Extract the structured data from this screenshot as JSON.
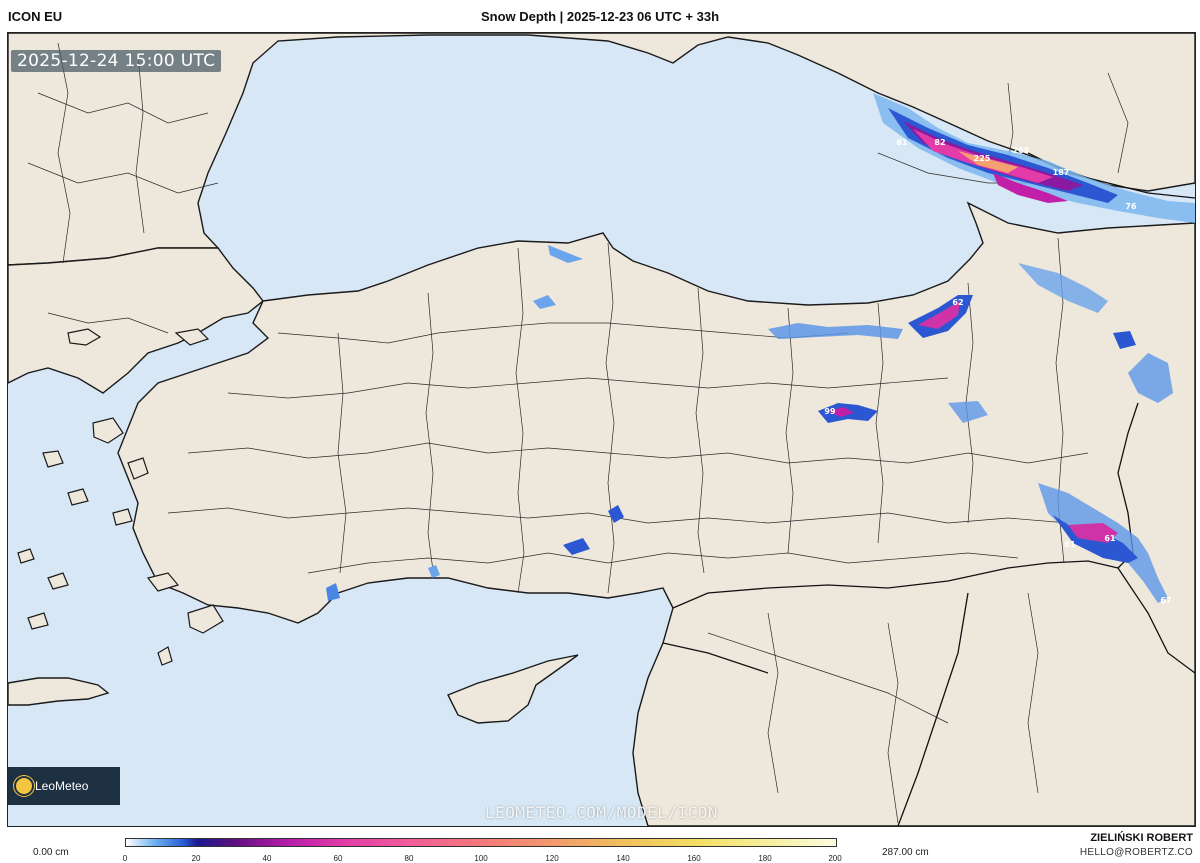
{
  "header": {
    "model": "ICON EU",
    "title": "Snow Depth | 2025-12-23 06 UTC + 33h"
  },
  "map": {
    "valid_time": "2025-12-24 15:00 UTC",
    "watermark": "LEOMETEO.COM/MODEL/ICON",
    "logo": "LeoMeteo",
    "colors": {
      "sea": "#d7e7f6",
      "land": "#eee7db",
      "border": "#1a1a1a"
    },
    "snow_labels": [
      "81",
      "82",
      "225",
      "268",
      "187",
      "76",
      "62",
      "99",
      "61",
      "61",
      "67"
    ]
  },
  "legend": {
    "min_label": "0.00 cm",
    "max_label": "287.00 cm",
    "ticks": [
      "0",
      "20",
      "40",
      "60",
      "80",
      "100",
      "120",
      "140",
      "160",
      "180",
      "200"
    ]
  },
  "footer": {
    "author": "ZIELIŃSKI ROBERT",
    "email": "HELLO@ROBERTZ.CO"
  }
}
